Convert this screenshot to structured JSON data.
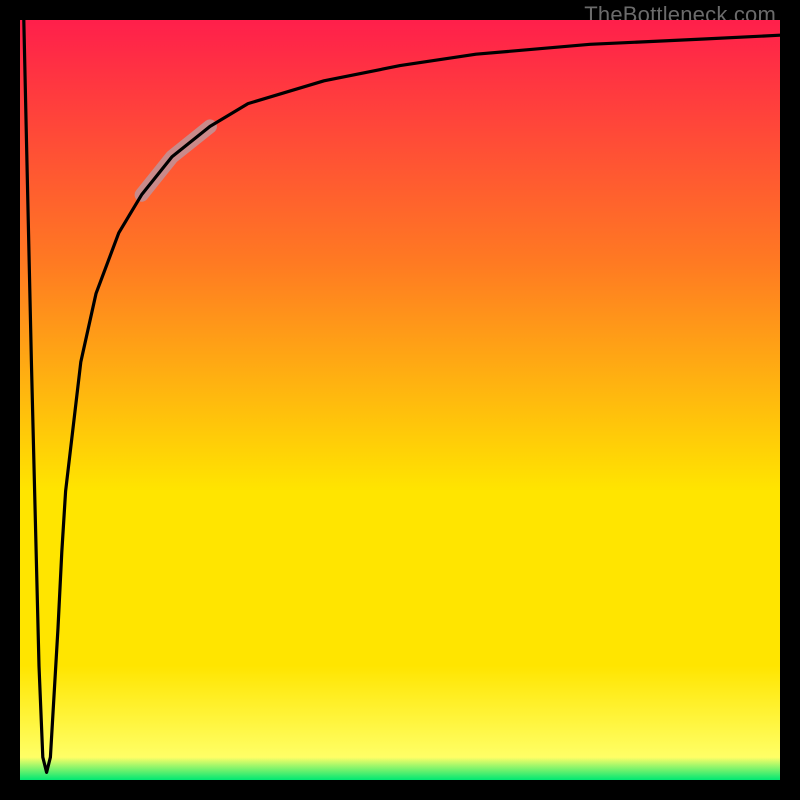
{
  "watermark": "TheBottleneck.com",
  "colors": {
    "frame": "#000000",
    "grad_top": "#ff1f4b",
    "grad_mid1": "#ff7a22",
    "grad_mid2": "#ffe500",
    "grad_low": "#ffff66",
    "grad_bottom": "#00e873",
    "curve": "#000000",
    "highlight": "#c98a8a"
  },
  "chart_data": {
    "type": "line",
    "title": "",
    "xlabel": "",
    "ylabel": "",
    "xlim": [
      0,
      100
    ],
    "ylim": [
      0,
      100
    ],
    "series": [
      {
        "name": "bottleneck-curve",
        "x": [
          0.5,
          1.5,
          2.5,
          3.0,
          3.5,
          4.0,
          5.0,
          5.5,
          6.0,
          8.0,
          10,
          13,
          16,
          20,
          25,
          30,
          40,
          50,
          60,
          75,
          90,
          100
        ],
        "values": [
          100,
          55,
          15,
          3,
          1,
          3,
          20,
          30,
          38,
          55,
          64,
          72,
          77,
          82,
          86,
          89,
          92,
          94,
          95.5,
          96.8,
          97.5,
          98
        ]
      }
    ],
    "highlight_segment": {
      "x_start": 16,
      "x_end": 25
    },
    "annotations": []
  }
}
